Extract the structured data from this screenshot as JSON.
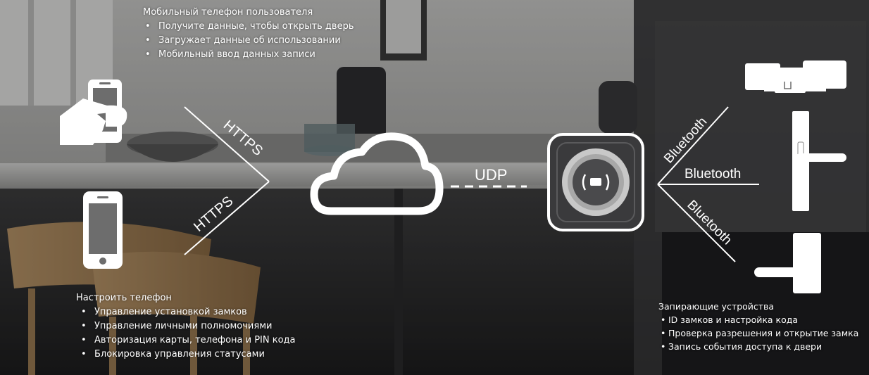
{
  "phone_user": {
    "heading": "Мобильный телефон пользователя",
    "items": [
      "Получите данные, чтобы открыть дверь",
      "Загружает данные об использовании",
      "Мобильный ввод данных записи"
    ]
  },
  "setup_phone": {
    "heading": "Настроить телефон",
    "items": [
      "Управление установкой замков",
      "Управление личными полномочиями",
      "Авторизация карты, телефона и PIN кода",
      "Блокировка управления статусами"
    ]
  },
  "locking_devices": {
    "heading": "Запирающие устройства",
    "items": [
      "ID замков и настройка кода",
      "Проверка разрешения и открытие замка",
      "Запись события доступа к двери"
    ]
  },
  "links": {
    "https_top": "HTTPS",
    "https_bottom": "HTTPS",
    "udp": "UDP",
    "bt_top": "Bluetooth",
    "bt_middle": "Bluetooth",
    "bt_bottom": "Bluetooth"
  },
  "icons": {
    "hand_phone": "hand-holding-phone-icon",
    "phone": "smartphone-icon",
    "cloud": "cloud-icon",
    "gateway": "nfc-gateway-icon",
    "rfid": "rfid-symbol-icon",
    "lock_top": "horizontal-door-lock-icon",
    "lock_mid": "vertical-door-lock-icon",
    "lock_bottom": "lever-door-lock-icon"
  }
}
